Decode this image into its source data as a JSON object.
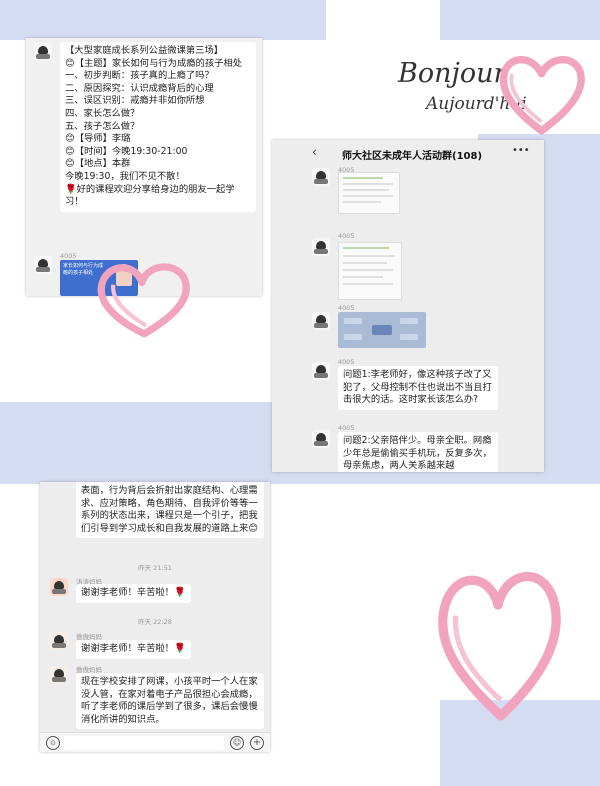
{
  "decor": {
    "bonjour": "Bonjour",
    "aujourdhui": "Aujourd'hui",
    "heart_color": "#f2a3bd",
    "band_color": "#d4dcf3"
  },
  "shot1": {
    "announcement": "【大型家庭成长系列公益微课第三场】\n😊【主题】家长如何与行为成瘾的孩子相处\n一、初步判断：孩子真的上瘾了吗？\n二、原因探究：认识成瘾背后的心理\n三、误区识别：戒瘾并非如你所想\n四、家长怎么做？\n五、孩子怎么做？\n😊【导师】李璐\n😊【时间】今晚19:30-21:00\n😊【地点】本群\n今晚19:30，我们不见不散！\n🌹好的课程欢迎分享给身边的朋友一起学习！",
    "sender": "4005",
    "poster_text": "家长如何与行为成瘾的孩子相处"
  },
  "shot2": {
    "title": "师大社区未成年人活动群(108)",
    "more_icon": "more-icon",
    "back_icon": "back-icon",
    "senders": [
      "4005",
      "4005",
      "4005",
      "4005"
    ],
    "q1": "问题1:李老师好，像这种孩子改了又犯了，父母控制不住也说出不当且打击很大的话。这时家长该怎么办?",
    "q2": "问题2:父亲陪伴少。母亲全职。网瘾少年总是偷偷买手机玩，反复多次，母亲焦虑，两人关系越来越"
  },
  "shot3": {
    "top_message": "表面，行为背后会折射出家庭结构、心理需求、应对策略，角色期待、自我评价等等一系列的状态出来，课程只是一个引子，把我们引导到学习成长和自我发展的道路上来😊",
    "time1": "昨天 21:51",
    "nick1": "涛涛妈妈",
    "msg1": "谢谢李老师！辛苦啦！🌹",
    "time2": "昨天 22:28",
    "nick2": "傲傲妈妈",
    "msg2": "谢谢李老师！辛苦啦！🌹",
    "nick3": "傲傲妈妈",
    "msg3": "现在学校安排了网课，小孩平时一个人在家没人管，在家对着电子产品很担心会成瘾，听了李老师的课后学到了很多，课后会慢慢消化所讲的知识点。"
  }
}
